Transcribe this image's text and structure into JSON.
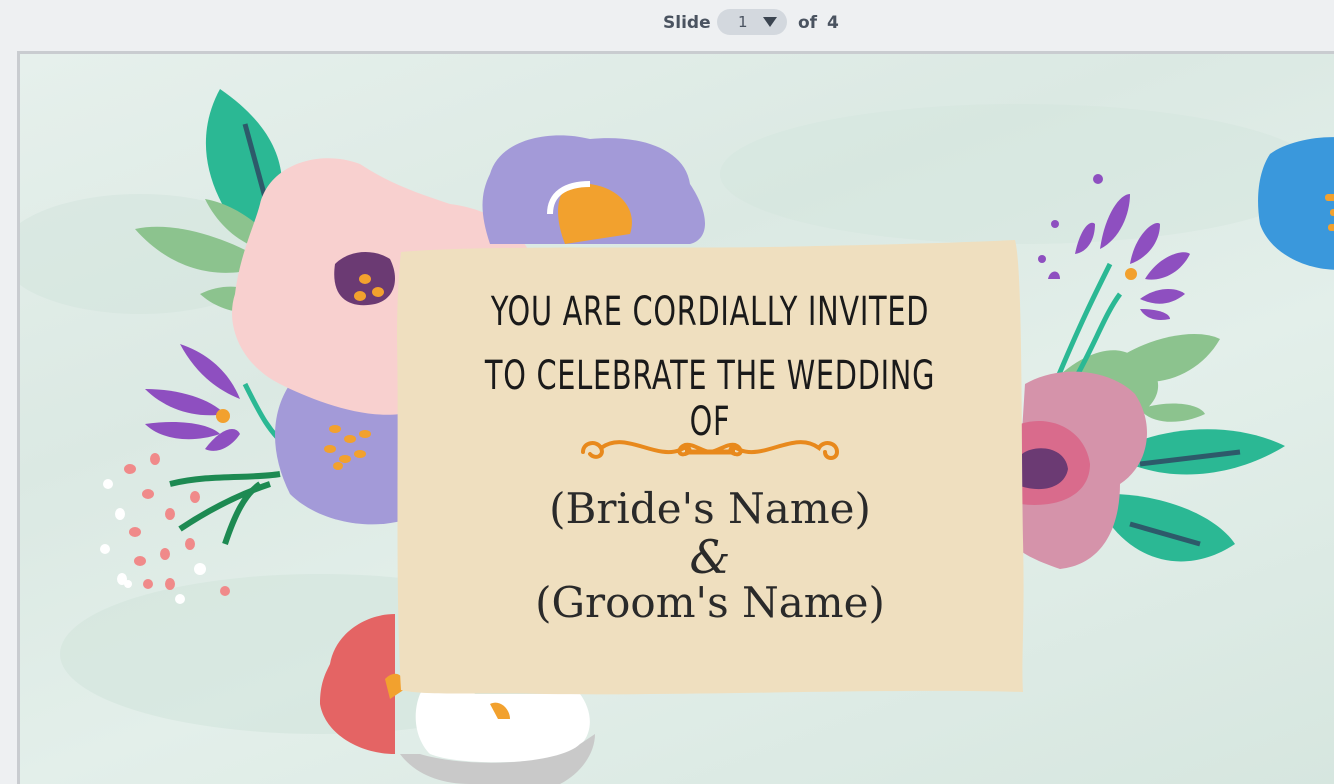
{
  "toolbar": {
    "slide_label": "Slide",
    "current_slide": "1",
    "of_label": "of",
    "total_slides": "4"
  },
  "invitation": {
    "line1": "You are cordially invited",
    "line2": "to celebrate the wedding of",
    "bride": "(Bride's Name)",
    "ampersand": "&",
    "groom": "(Groom's Name)"
  },
  "colors": {
    "background": "#dfece6",
    "card": "#efdfbf",
    "ornament": "#e8891c",
    "text": "#1a1a1a"
  },
  "icons": {
    "dropdown": "chevron-down-icon",
    "ornament": "flourish-divider-icon"
  }
}
